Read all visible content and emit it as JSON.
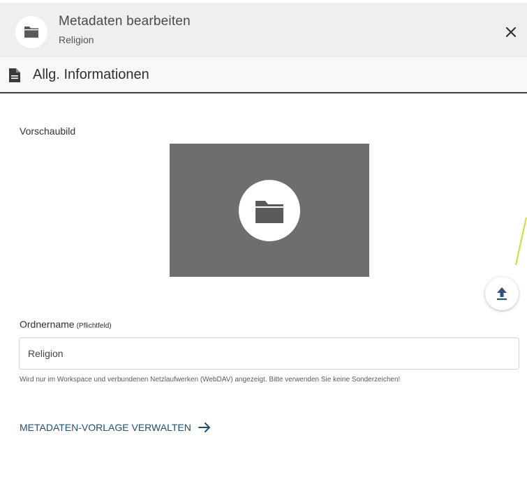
{
  "header": {
    "title": "Metadaten bearbeiten",
    "subtitle": "Religion",
    "icon": "folder-icon",
    "close_icon": "close-icon"
  },
  "section": {
    "title": "Allg. Informationen",
    "icon": "document-icon"
  },
  "preview": {
    "label": "Vorschaubild",
    "icon": "folder-icon",
    "upload_icon": "upload-icon"
  },
  "name_field": {
    "label": "Ordnername",
    "required_note": "(Pflichtfeld)",
    "value": "Religion",
    "hint": "Wird nur im Workspace und verbundenen Netzlaufwerken (WebDAV) angezeigt. Bitte verwenden Sie keine Sonderzeichen!"
  },
  "template_link": {
    "label": "METADATEN-VORLAGE VERWALTEN",
    "icon": "arrow-right-icon"
  },
  "colors": {
    "header_bg": "#efefef",
    "preview_bg": "#6e6e6e",
    "link": "#1d4f73",
    "annotation": "#d6dc2a"
  }
}
